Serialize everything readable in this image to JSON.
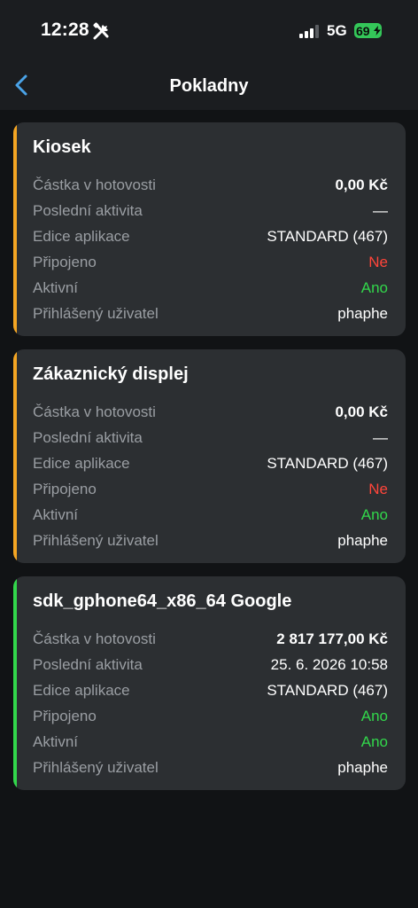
{
  "status_bar": {
    "time": "12:28",
    "network": "5G",
    "battery": "69"
  },
  "nav": {
    "title": "Pokladny"
  },
  "colors": {
    "orange_accent": "#f5a623",
    "green_accent": "#32d74b",
    "negative": "#ff453a",
    "positive": "#32d74b"
  },
  "cards": [
    {
      "title": "Kiosek",
      "accent": "orange",
      "rows": [
        {
          "label": "Částka v hotovosti",
          "value": "0,00 Kč"
        },
        {
          "label": "Poslední aktivita",
          "value": "—"
        },
        {
          "label": "Edice aplikace",
          "value": "STANDARD (467)"
        },
        {
          "label": "Připojeno",
          "value": "Ne"
        },
        {
          "label": "Aktivní",
          "value": "Ano"
        },
        {
          "label": "Přihlášený uživatel",
          "value": "phaphe"
        }
      ]
    },
    {
      "title": "Zákaznický displej",
      "accent": "orange",
      "rows": [
        {
          "label": "Částka v hotovosti",
          "value": "0,00 Kč"
        },
        {
          "label": "Poslední aktivita",
          "value": "—"
        },
        {
          "label": "Edice aplikace",
          "value": "STANDARD (467)"
        },
        {
          "label": "Připojeno",
          "value": "Ne"
        },
        {
          "label": "Aktivní",
          "value": "Ano"
        },
        {
          "label": "Přihlášený uživatel",
          "value": "phaphe"
        }
      ]
    },
    {
      "title": "sdk_gphone64_x86_64 Google",
      "accent": "green",
      "rows": [
        {
          "label": "Částka v hotovosti",
          "value": "2 817 177,00 Kč"
        },
        {
          "label": "Poslední aktivita",
          "value": "25. 6. 2026 10:58"
        },
        {
          "label": "Edice aplikace",
          "value": "STANDARD (467)"
        },
        {
          "label": "Připojeno",
          "value": "Ano"
        },
        {
          "label": "Aktivní",
          "value": "Ano"
        },
        {
          "label": "Přihlášený uživatel",
          "value": "phaphe"
        }
      ]
    }
  ]
}
